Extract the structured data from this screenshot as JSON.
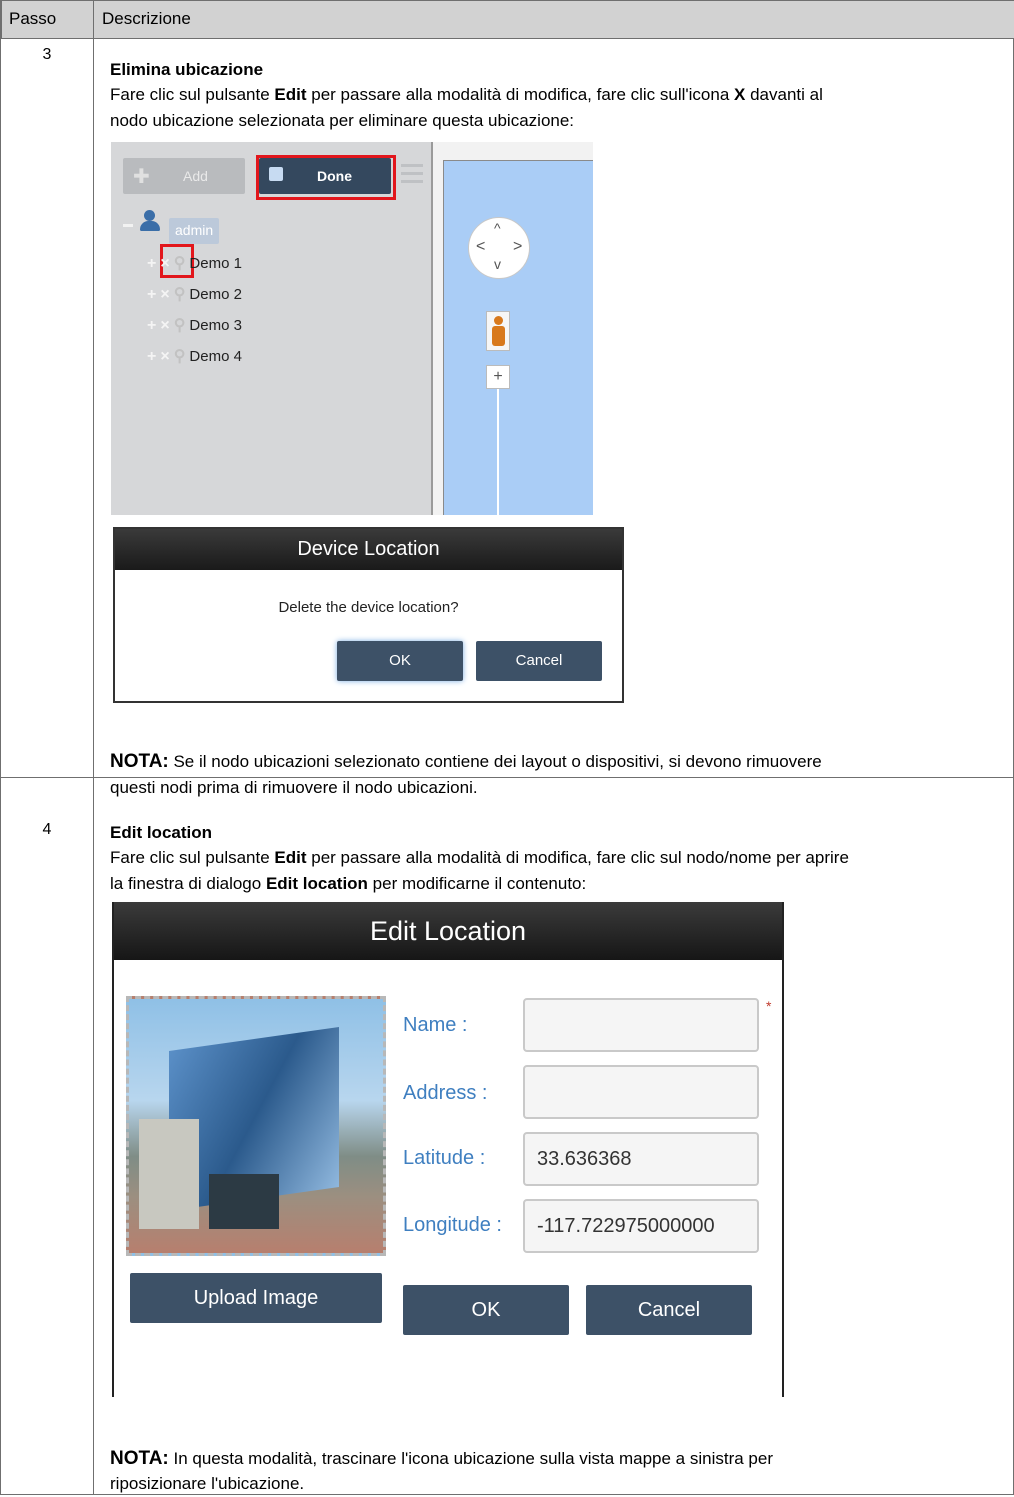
{
  "table": {
    "col_step": "Passo",
    "col_desc": "Descrizione"
  },
  "step3": {
    "number": "3",
    "title": "Elimina ubicazione",
    "text_1": "Fare clic sul pulsante ",
    "text_edit": "Edit",
    "text_2": " per passare alla modalità di modifica, fare clic sull'icona ",
    "text_x": "X",
    "text_3": " davanti al",
    "text_4": "nodo ubicazione selezionata per eliminare questa ubicazione:",
    "note_label": "NOTA:",
    "note_text_1": " Se il nodo ubicazioni selezionato contiene dei layout o dispositivi, si devono rimuovere",
    "note_text_2": "questi nodi prima di rimuovere il nodo ubicazioni."
  },
  "screenshot1": {
    "add_label": "Add",
    "done_label": "Done",
    "root_label": "admin",
    "tree": [
      "Demo 1",
      "Demo 2",
      "Demo 3",
      "Demo 4"
    ]
  },
  "dialog1": {
    "title": "Device Location",
    "message": "Delete the device location?",
    "ok": "OK",
    "cancel": "Cancel"
  },
  "step4": {
    "number": "4",
    "title": "Edit location",
    "text_1": "Fare clic sul pulsante ",
    "text_edit": "Edit",
    "text_2": " per passare alla modalità di modifica, fare clic sul nodo/nome per aprire",
    "text_3": "la finestra di dialogo ",
    "text_dialog": "Edit location",
    "text_4": " per modificarne il contenuto:",
    "note_label": "NOTA:",
    "note_text_1": " In questa modalità, trascinare l'icona ubicazione sulla vista mappe a sinistra per",
    "note_text_2": "riposizionare l'ubicazione."
  },
  "dialog2": {
    "title": "Edit Location",
    "name_label": "Name :",
    "address_label": "Address :",
    "latitude_label": "Latitude :",
    "longitude_label": "Longitude :",
    "name_value": "",
    "address_value": "",
    "latitude_value": "33.636368",
    "longitude_value": "-117.722975000000",
    "required_mark": "*",
    "upload": "Upload Image",
    "ok": "OK",
    "cancel": "Cancel"
  },
  "colors": {
    "header_bg": "#d2d2d2",
    "dark_button": "#3d5167",
    "label_blue": "#3f7fc0",
    "highlight_red": "#e2161c",
    "map_blue": "#aacdf6"
  }
}
